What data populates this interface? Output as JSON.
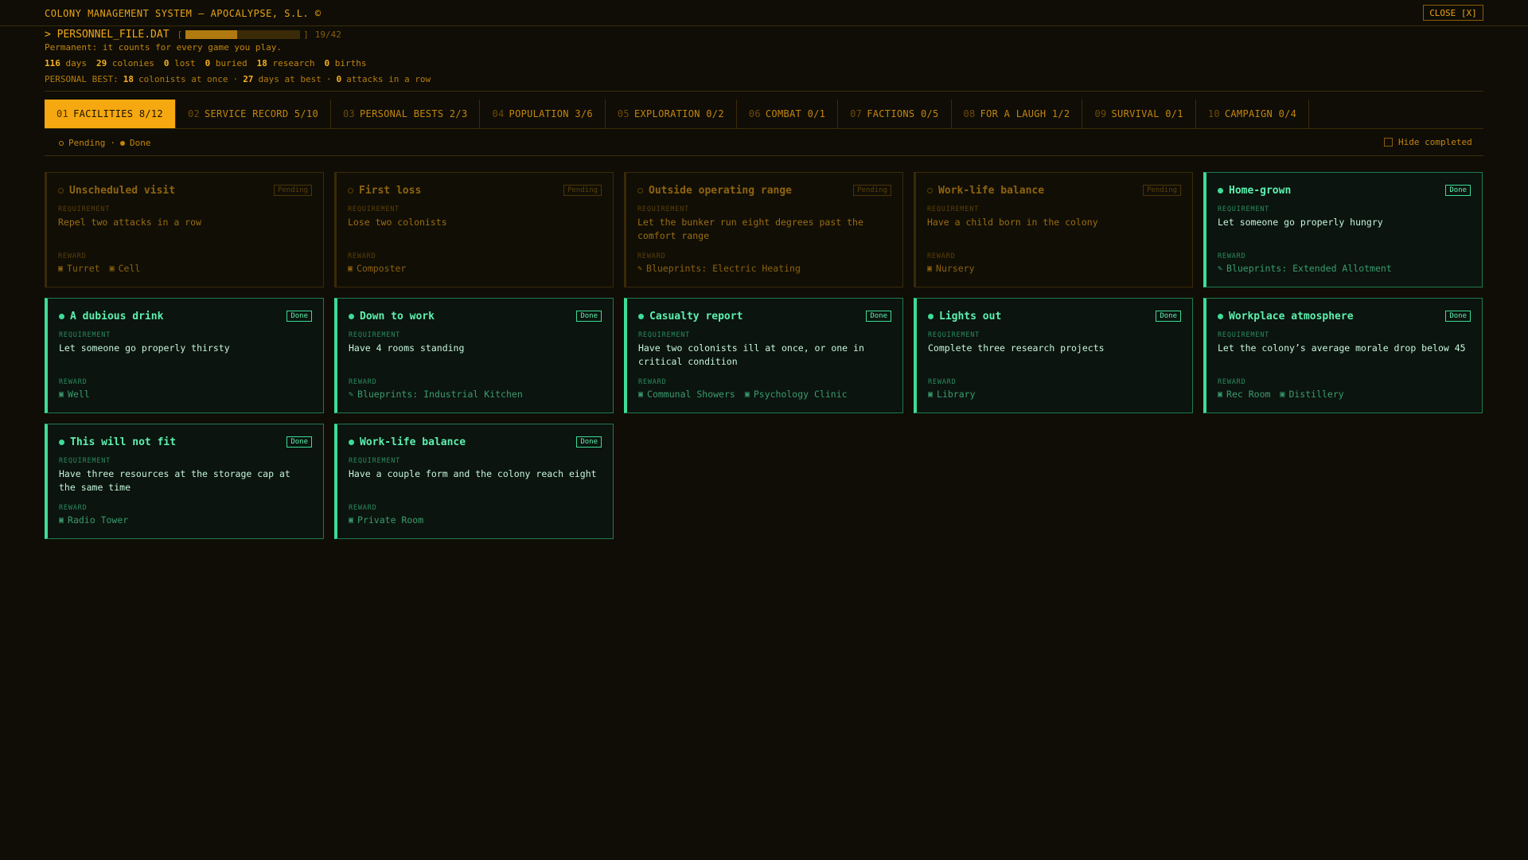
{
  "app": {
    "title": "COLONY MANAGEMENT SYSTEM — APOCALYPSE, S.L. ©",
    "close_label": "CLOSE [X]"
  },
  "file": {
    "name": "> PERSONNEL_FILE.DAT",
    "bracket_open": "[",
    "bracket_close": "]",
    "progress_count": "19/42",
    "progress_fraction": 0.452,
    "note": "Permanent: it counts for every game you play."
  },
  "stats": [
    {
      "value": "116",
      "label": "days"
    },
    {
      "value": "29",
      "label": "colonies"
    },
    {
      "value": "0",
      "label": "lost"
    },
    {
      "value": "0",
      "label": "buried"
    },
    {
      "value": "18",
      "label": "research"
    },
    {
      "value": "0",
      "label": "births"
    }
  ],
  "personal_best": {
    "prefix": "PERSONAL BEST:",
    "colonists_value": "18",
    "colonists_label": "colonists at once",
    "sep": "·",
    "days_value": "27",
    "days_label": "days at best",
    "attacks_value": "0",
    "attacks_label": "attacks in a row"
  },
  "tabs": [
    {
      "num": "01",
      "label": "FACILITIES 8/12",
      "active": true
    },
    {
      "num": "02",
      "label": "SERVICE RECORD 5/10"
    },
    {
      "num": "03",
      "label": "PERSONAL BESTS 2/3"
    },
    {
      "num": "04",
      "label": "POPULATION 3/6"
    },
    {
      "num": "05",
      "label": "EXPLORATION 0/2"
    },
    {
      "num": "06",
      "label": "COMBAT 0/1"
    },
    {
      "num": "07",
      "label": "FACTIONS 0/5"
    },
    {
      "num": "08",
      "label": "FOR A LAUGH 1/2"
    },
    {
      "num": "09",
      "label": "SURVIVAL 0/1"
    },
    {
      "num": "10",
      "label": "CAMPAIGN 0/4"
    }
  ],
  "legend": {
    "pending": "Pending",
    "sep": "·",
    "done": "Done",
    "hide_completed": "Hide completed"
  },
  "labels": {
    "requirement": "REQUIREMENT",
    "reward": "REWARD"
  },
  "cards": [
    {
      "title": "Unscheduled visit",
      "status": "Pending",
      "state": "pending",
      "requirement": "Repel two attacks in a row",
      "rewards": [
        {
          "icon": "block-icon",
          "glyph": "▣",
          "text": "Turret"
        },
        {
          "icon": "block-icon",
          "glyph": "▣",
          "text": "Cell"
        }
      ]
    },
    {
      "title": "First loss",
      "status": "Pending",
      "state": "pending",
      "requirement": "Lose two colonists",
      "rewards": [
        {
          "icon": "block-icon",
          "glyph": "▣",
          "text": "Composter"
        }
      ]
    },
    {
      "title": "Outside operating range",
      "status": "Pending",
      "state": "pending",
      "requirement": "Let the bunker run eight degrees past the comfort range",
      "rewards": [
        {
          "icon": "pencil-icon",
          "glyph": "✎",
          "text": "Blueprints: Electric Heating"
        }
      ]
    },
    {
      "title": "Work-life balance",
      "status": "Pending",
      "state": "pending",
      "requirement": "Have a child born in the colony",
      "rewards": [
        {
          "icon": "block-icon",
          "glyph": "▣",
          "text": "Nursery"
        }
      ]
    },
    {
      "title": "Home-grown",
      "status": "Done",
      "state": "done",
      "requirement": "Let someone go properly hungry",
      "rewards": [
        {
          "icon": "pencil-icon",
          "glyph": "✎",
          "text": "Blueprints: Extended Allotment"
        }
      ]
    },
    {
      "title": "A dubious drink",
      "status": "Done",
      "state": "done",
      "requirement": "Let someone go properly thirsty",
      "rewards": [
        {
          "icon": "block-icon",
          "glyph": "▣",
          "text": "Well"
        }
      ]
    },
    {
      "title": "Down to work",
      "status": "Done",
      "state": "done",
      "requirement": "Have 4 rooms standing",
      "rewards": [
        {
          "icon": "pencil-icon",
          "glyph": "✎",
          "text": "Blueprints: Industrial Kitchen"
        }
      ]
    },
    {
      "title": "Casualty report",
      "status": "Done",
      "state": "done",
      "requirement": "Have two colonists ill at once, or one in critical condition",
      "rewards": [
        {
          "icon": "block-icon",
          "glyph": "▣",
          "text": "Communal Showers"
        },
        {
          "icon": "block-icon",
          "glyph": "▣",
          "text": "Psychology Clinic"
        }
      ]
    },
    {
      "title": "Lights out",
      "status": "Done",
      "state": "done",
      "requirement": "Complete three research projects",
      "rewards": [
        {
          "icon": "block-icon",
          "glyph": "▣",
          "text": "Library"
        }
      ]
    },
    {
      "title": "Workplace atmosphere",
      "status": "Done",
      "state": "done",
      "requirement": "Let the colony’s average morale drop below 45",
      "rewards": [
        {
          "icon": "block-icon",
          "glyph": "▣",
          "text": "Rec Room"
        },
        {
          "icon": "block-icon",
          "glyph": "▣",
          "text": "Distillery"
        }
      ]
    },
    {
      "title": "This will not fit",
      "status": "Done",
      "state": "done",
      "requirement": "Have three resources at the storage cap at the same time",
      "rewards": [
        {
          "icon": "block-icon",
          "glyph": "▣",
          "text": "Radio Tower"
        }
      ]
    },
    {
      "title": "Work-life balance",
      "status": "Done",
      "state": "done",
      "requirement": "Have a couple form and the colony reach eight",
      "rewards": [
        {
          "icon": "block-icon",
          "glyph": "▣",
          "text": "Private Room"
        }
      ]
    }
  ],
  "colors": {
    "background": "#0f0d06",
    "amber": "#f5a80f",
    "done_green": "#3ddc97"
  }
}
